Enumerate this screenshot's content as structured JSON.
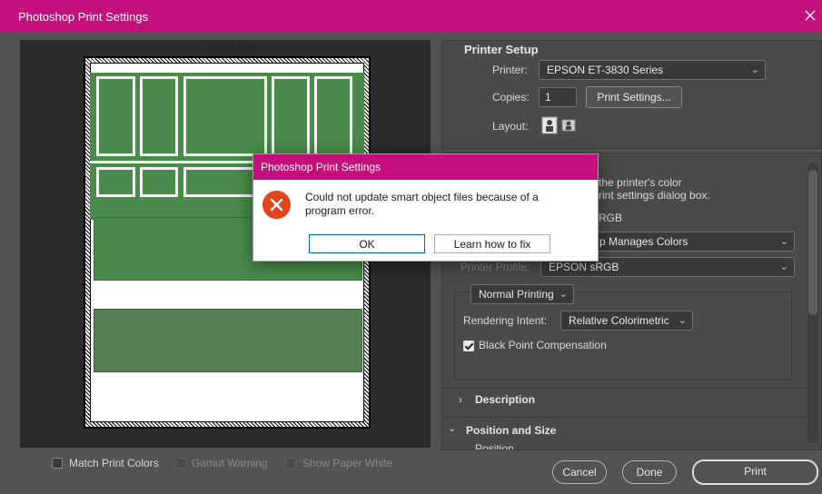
{
  "window": {
    "title": "Photoshop Print Settings"
  },
  "preview": {
    "paper_size_label": "8.5 in x 11 in"
  },
  "printer_setup": {
    "heading": "Printer Setup",
    "printer_label": "Printer:",
    "printer_value": "EPSON ET-3830 Series",
    "copies_label": "Copies:",
    "copies_value": "1",
    "print_settings_button": "Print Settings...",
    "layout_label": "Layout:"
  },
  "color_management": {
    "partial_line1": "the printer's color",
    "partial_line2": "rint settings dialog box.",
    "partial_rgb": "RGB",
    "color_handling_value": "p Manages Colors",
    "printer_profile_label": "Printer Profile:",
    "printer_profile_value": "EPSON  sRGB",
    "normal_printing_value": "Normal Printing",
    "rendering_intent_label": "Rendering Intent:",
    "rendering_intent_value": "Relative Colorimetric",
    "black_point_label": "Black Point Compensation",
    "black_point_checked": true
  },
  "sections": {
    "description": "Description",
    "position_and_size": "Position and Size",
    "position": "Position"
  },
  "bottom": {
    "match_print_colors": "Match Print Colors",
    "gamut_warning": "Gamut Warning",
    "show_paper_white": "Show Paper White",
    "cancel": "Cancel",
    "done": "Done",
    "print": "Print"
  },
  "modal": {
    "title": "Photoshop Print Settings",
    "message": "Could not update smart object files because of a program error.",
    "ok": "OK",
    "learn": "Learn how to fix"
  },
  "colors": {
    "accent": "#c4107c",
    "error": "#e2461b",
    "background": "#535353"
  }
}
